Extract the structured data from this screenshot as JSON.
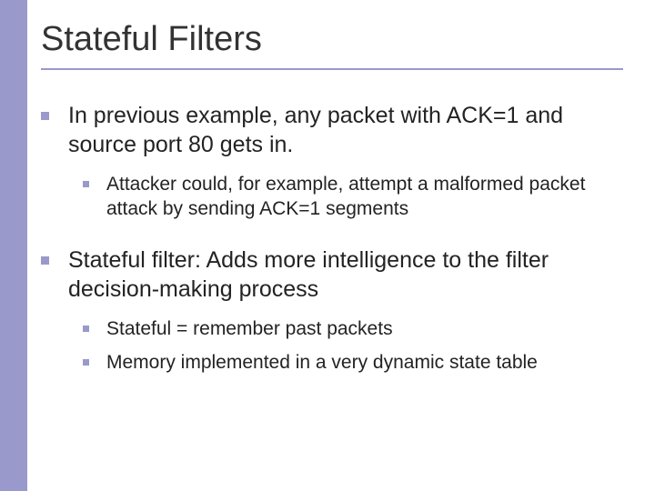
{
  "title": "Stateful Filters",
  "items": [
    {
      "text": "In previous example, any packet with ACK=1 and source port 80 gets in.",
      "sub": [
        "Attacker could, for example, attempt a malformed packet attack by sending ACK=1 segments"
      ]
    },
    {
      "text": "Stateful filter: Adds more intelligence to the filter decision-making process",
      "sub": [
        "Stateful = remember past packets",
        "Memory implemented in a very dynamic state table"
      ]
    }
  ]
}
